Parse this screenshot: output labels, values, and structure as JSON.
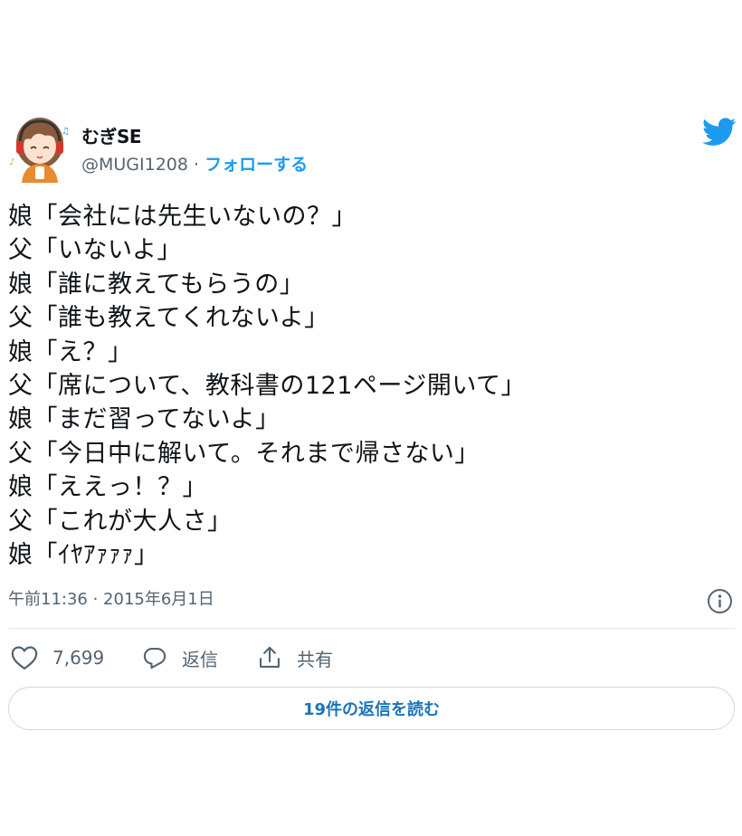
{
  "author": {
    "display_name": "むぎSE",
    "handle": "@MUGI1208",
    "separator": " · ",
    "follow_label": "フォローする",
    "avatar_icon": "avatar-girl-headphones-icon"
  },
  "brand": {
    "logo_icon": "twitter-bird-icon",
    "color": "#1d9bf0"
  },
  "tweet": {
    "lines": [
      "娘「会社には先生いないの？」",
      "父「いないよ」",
      "娘「誰に教えてもらうの」",
      "父「誰も教えてくれないよ」",
      "娘「え？」",
      "父「席について、教科書の121ページ開いて」",
      "娘「まだ習ってないよ」",
      "父「今日中に解いて。それまで帰さない」",
      "娘「ええっ！？」",
      "父「これが大人さ」",
      "娘「ｲﾔｱｧｧｧ」"
    ],
    "timestamp": "午前11:36 · 2015年6月1日"
  },
  "actions": {
    "like_count": "7,699",
    "reply_label": "返信",
    "share_label": "共有"
  },
  "replies_button": {
    "label": "19件の返信を読む"
  },
  "colors": {
    "text_primary": "#0f1419",
    "text_secondary": "#536471",
    "link": "#1d9bf0",
    "border": "#cfd9de"
  }
}
